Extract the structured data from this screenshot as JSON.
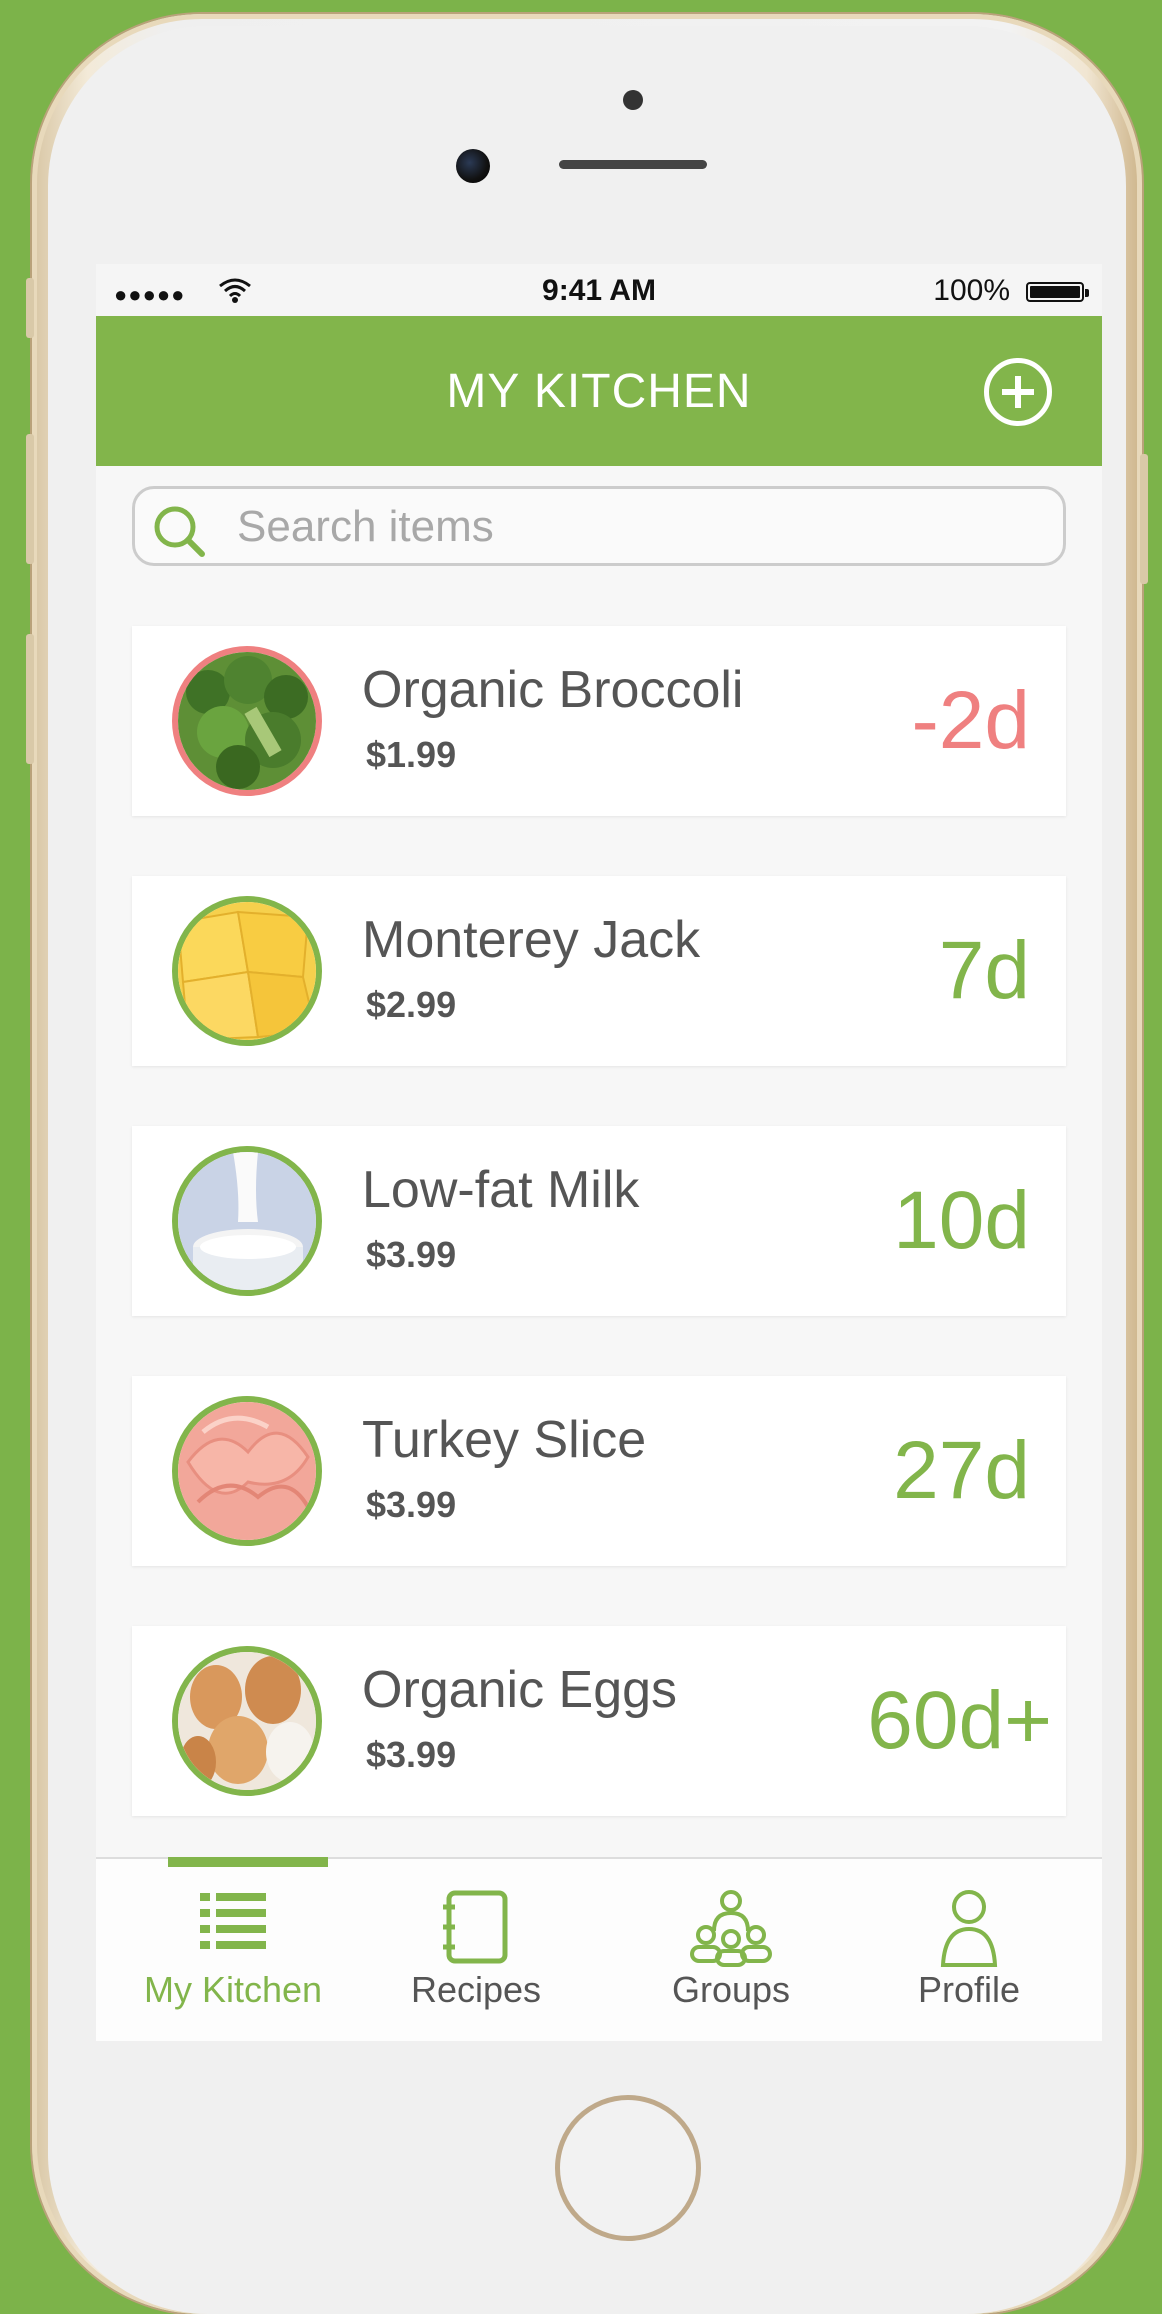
{
  "status_bar": {
    "signal": "●●●●●",
    "time": "9:41 AM",
    "battery": "100%"
  },
  "header": {
    "title": "MY KITCHEN",
    "add_icon": "plus-circle-icon"
  },
  "search": {
    "placeholder": "Search items",
    "value": "",
    "icon": "search-icon"
  },
  "items": [
    {
      "name": "Organic Broccoli",
      "price": "$1.99",
      "days": "-2d",
      "status": "expired",
      "image": "broccoli"
    },
    {
      "name": "Monterey Jack",
      "price": "$2.99",
      "days": "7d",
      "status": "fresh",
      "image": "cheese"
    },
    {
      "name": "Low-fat Milk",
      "price": "$3.99",
      "days": "10d",
      "status": "fresh",
      "image": "milk"
    },
    {
      "name": "Turkey Slice",
      "price": "$3.99",
      "days": "27d",
      "status": "fresh",
      "image": "turkey"
    },
    {
      "name": "Organic Eggs",
      "price": "$3.99",
      "days": "60d+",
      "status": "fresh",
      "image": "eggs"
    }
  ],
  "tabs": [
    {
      "label": "My Kitchen",
      "icon": "list-icon",
      "active": true
    },
    {
      "label": "Recipes",
      "icon": "notebook-icon",
      "active": false
    },
    {
      "label": "Groups",
      "icon": "group-icon",
      "active": false
    },
    {
      "label": "Profile",
      "icon": "person-icon",
      "active": false
    }
  ],
  "colors": {
    "brand_green": "#82b54b",
    "expired_red": "#ef8080",
    "background_green": "#7cb34a"
  }
}
